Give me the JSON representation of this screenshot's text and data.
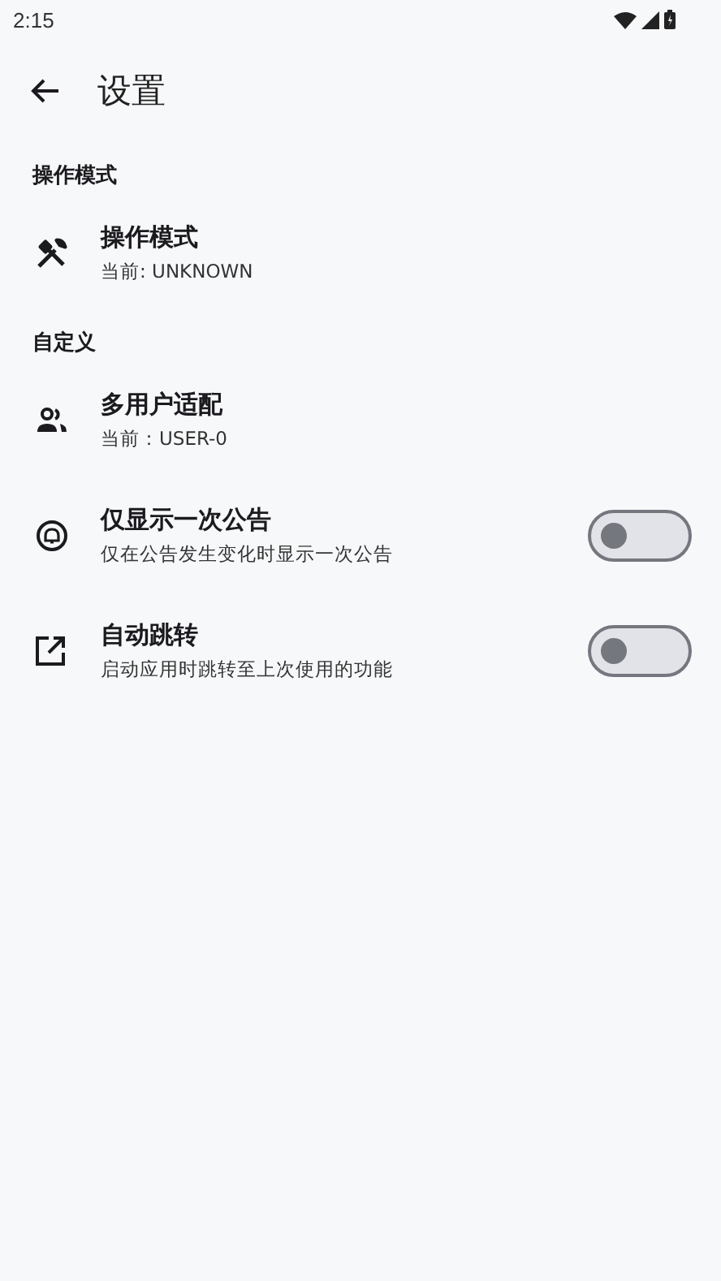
{
  "status_bar": {
    "time": "2:15"
  },
  "app_bar": {
    "title": "设置"
  },
  "sections": [
    {
      "header": "操作模式",
      "items": [
        {
          "kind": "info",
          "title": "操作模式",
          "subtitle": "当前: UNKNOWN"
        }
      ]
    },
    {
      "header": "自定义",
      "items": [
        {
          "kind": "info",
          "title": "多用户适配",
          "subtitle": "当前：USER-0"
        },
        {
          "kind": "switch",
          "title": "仅显示一次公告",
          "subtitle": "仅在公告发生变化时显示一次公告",
          "on": false
        },
        {
          "kind": "switch",
          "title": "自动跳转",
          "subtitle": "启动应用时跳转至上次使用的功能",
          "on": false
        }
      ]
    }
  ]
}
